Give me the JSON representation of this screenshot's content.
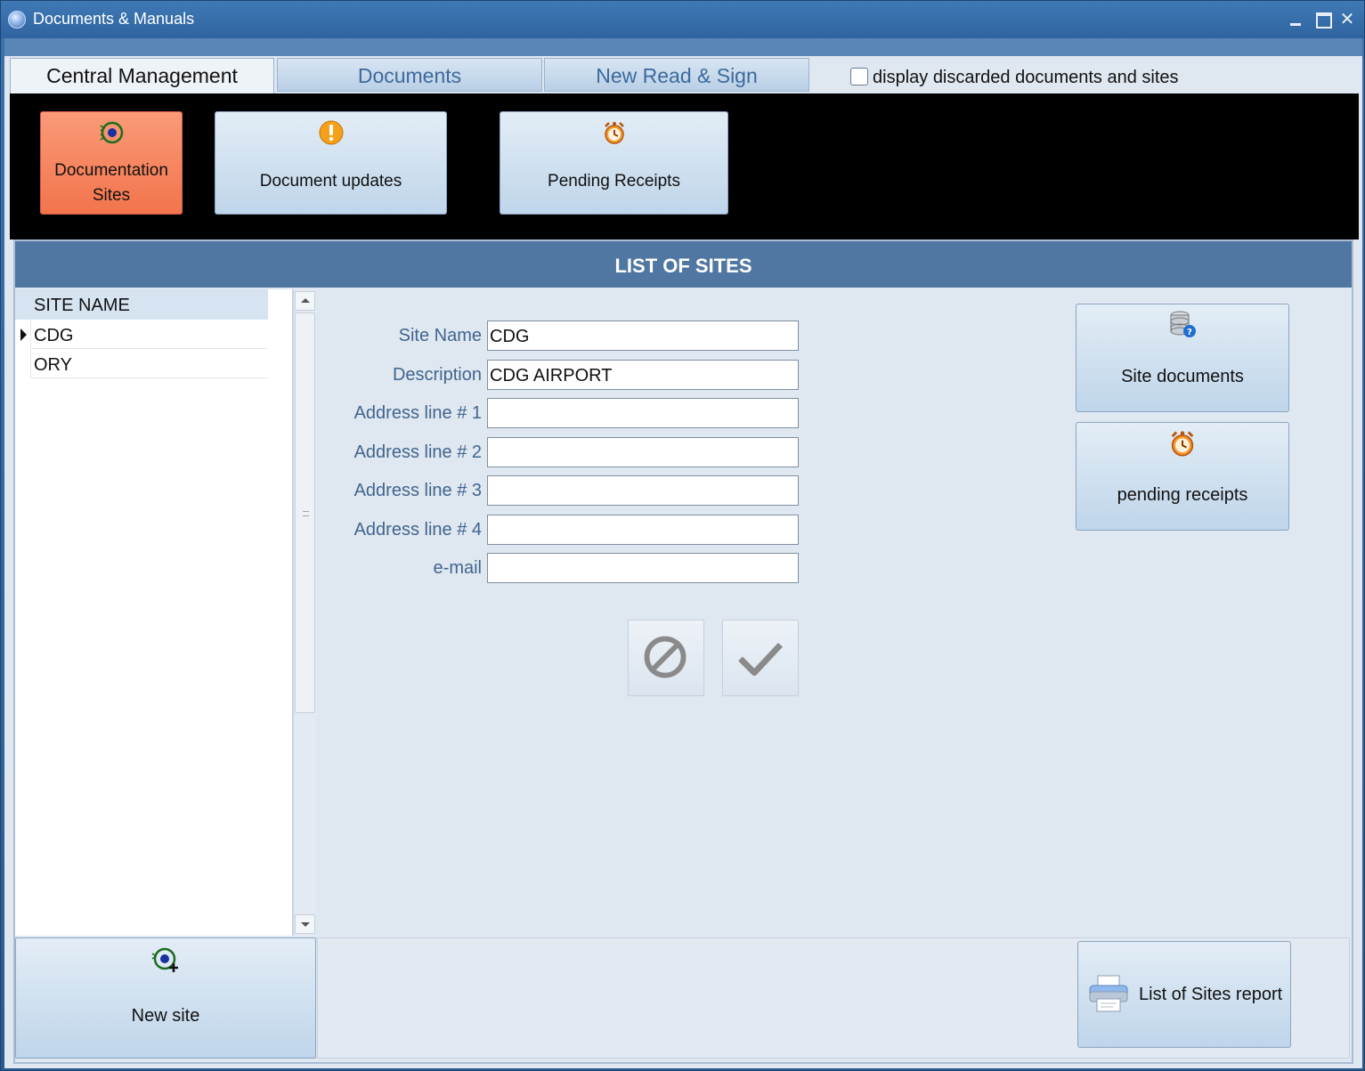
{
  "window": {
    "title": "Documents & Manuals"
  },
  "tabs": [
    {
      "label": "Central Management",
      "active": true
    },
    {
      "label": "Documents",
      "active": false
    },
    {
      "label": "New Read & Sign",
      "active": false
    }
  ],
  "discard_option": {
    "label": "display discarded documents and sites",
    "checked": false
  },
  "ribbon": {
    "buttons": [
      {
        "label_line1": "Documentation",
        "label_line2": "Sites",
        "icon": "site-target-icon",
        "selected": true
      },
      {
        "label": "Document updates",
        "icon": "warning-icon",
        "selected": false
      },
      {
        "label": "Pending Receipts",
        "icon": "alarm-clock-icon",
        "selected": false
      }
    ]
  },
  "panel": {
    "title": "LIST OF SITES"
  },
  "site_grid": {
    "column": "SITE NAME",
    "rows": [
      {
        "name": "CDG",
        "current": true
      },
      {
        "name": "ORY",
        "current": false
      }
    ]
  },
  "form": {
    "fields": [
      {
        "label": "Site Name",
        "value": "CDG"
      },
      {
        "label": "Description",
        "value": "CDG AIRPORT"
      },
      {
        "label": "Address line # 1",
        "value": ""
      },
      {
        "label": "Address line # 2",
        "value": ""
      },
      {
        "label": "Address line # 3",
        "value": ""
      },
      {
        "label": "Address line # 4",
        "value": ""
      },
      {
        "label": "e-mail",
        "value": ""
      }
    ]
  },
  "side_buttons": {
    "site_documents": "Site documents",
    "pending_receipts": "pending receipts"
  },
  "bottom": {
    "new_site": "New site",
    "report": "List of Sites report"
  },
  "colors": {
    "titlebar": "#3b72ad",
    "selected_button": "#f2744c",
    "panel_header": "#5077a2",
    "label_text": "#41658f"
  }
}
